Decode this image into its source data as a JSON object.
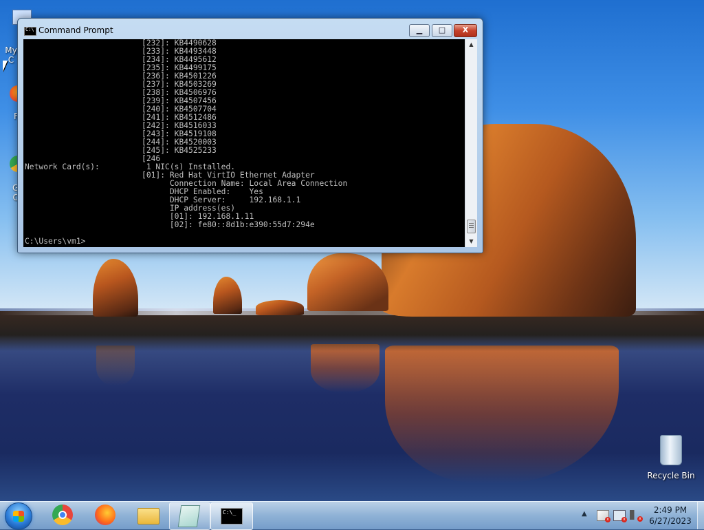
{
  "desktop": {
    "icons": [
      {
        "label": "My C"
      },
      {
        "label": "F"
      },
      {
        "label": "G\nC"
      },
      {
        "label": "Recycle Bin"
      }
    ]
  },
  "window": {
    "title": "Command Prompt",
    "min_label": "▁",
    "max_label": "□",
    "close_label": "X",
    "icon_text": "C:\\",
    "console_lines": [
      "                         [232]: KB4490628",
      "                         [233]: KB4493448",
      "                         [234]: KB4495612",
      "                         [235]: KB4499175",
      "                         [236]: KB4501226",
      "                         [237]: KB4503269",
      "                         [238]: KB4506976",
      "                         [239]: KB4507456",
      "                         [240]: KB4507704",
      "                         [241]: KB4512486",
      "                         [242]: KB4516033",
      "                         [243]: KB4519108",
      "                         [244]: KB4520003",
      "                         [245]: KB4525233",
      "                         [246",
      "Network Card(s):          1 NIC(s) Installed.",
      "                         [01]: Red Hat VirtIO Ethernet Adapter",
      "                               Connection Name: Local Area Connection",
      "                               DHCP Enabled:    Yes",
      "                               DHCP Server:     192.168.1.1",
      "                               IP address(es)",
      "                               [01]: 192.168.1.11",
      "                               [02]: fe80::8d1b:e390:55d7:294e",
      "",
      "C:\\Users\\vm1>"
    ],
    "scroll_up": "▲",
    "scroll_down": "▼"
  },
  "taskbar": {
    "apps": [
      {
        "name": "Google Chrome",
        "icon": "chrome-icon"
      },
      {
        "name": "Firefox",
        "icon": "firefox-icon"
      },
      {
        "name": "Windows Explorer",
        "icon": "folder-icon"
      },
      {
        "name": "Notepad",
        "icon": "notepad-icon"
      },
      {
        "name": "Command Prompt",
        "icon": "cmd-icon",
        "icon_text": "C:\\_"
      }
    ],
    "tray_arrow": "▲",
    "tray_x": "x",
    "clock_time": "2:49 PM",
    "clock_date": "6/27/2023"
  }
}
